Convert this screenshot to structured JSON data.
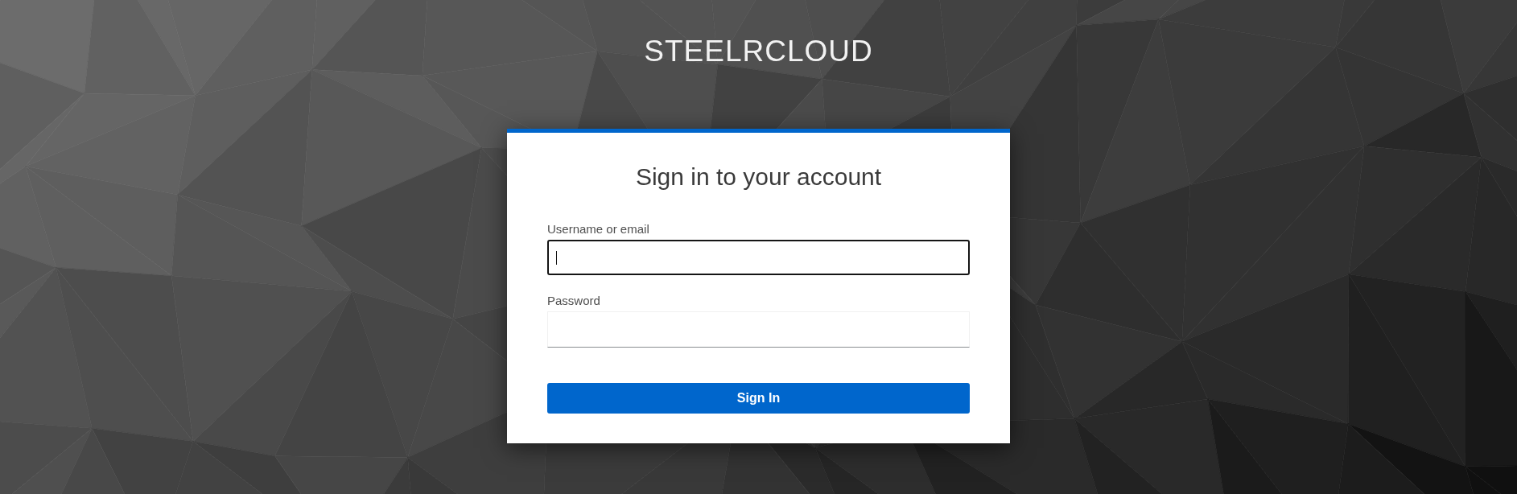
{
  "brand": {
    "title": "STEELRCLOUD"
  },
  "login_card": {
    "heading": "Sign in to your account",
    "fields": [
      {
        "label": "Username or email",
        "focused": true
      },
      {
        "label": "Password",
        "focused": false
      }
    ],
    "submit_button": {
      "label": "Sign In"
    }
  }
}
